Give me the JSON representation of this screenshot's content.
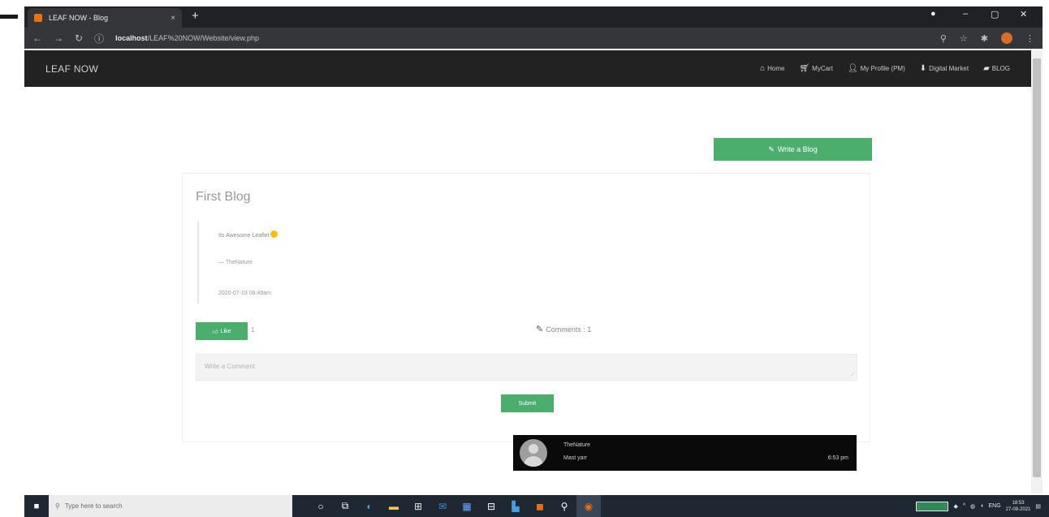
{
  "browser": {
    "tab_title": "LEAF NOW - Blog",
    "tab_close": "×",
    "new_tab": "+",
    "url_host": "localhost",
    "url_path": "/LEAF%20NOW/Website/view.php",
    "win_min": "–",
    "win_max": "▢",
    "win_close": "✕"
  },
  "navbar": {
    "brand": "LEAF NOW",
    "items": [
      {
        "icon": "home-icon",
        "label": "Home"
      },
      {
        "icon": "cart-icon",
        "label": "MyCart"
      },
      {
        "icon": "user-icon",
        "label": "My Profile (PM)"
      },
      {
        "icon": "location-icon",
        "label": "Digital Market"
      },
      {
        "icon": "chat-icon",
        "label": "BLOG"
      }
    ]
  },
  "page": {
    "write_blog_label": "Write a Blog",
    "blog_title": "First Blog",
    "blog_text": "Its Awesome Leaflet",
    "blog_author": "— TheNature",
    "blog_date": "2020-07-19 08:49am",
    "like_label": "Like",
    "like_count": "1",
    "comments_label": "Comments : 1",
    "comment_placeholder": "Write a Comment",
    "submit_label": "Submit"
  },
  "toast": {
    "name": "TheNature",
    "message": "Mast yarr",
    "time": "6:53 pm"
  },
  "taskbar": {
    "search_placeholder": "Type here to search",
    "language": "ENG",
    "time": "18:53",
    "date": "27-09-2021"
  },
  "colors": {
    "accent_green": "#4cae6d",
    "navbar_bg": "#222222",
    "toast_bg": "#0a0a0a"
  }
}
